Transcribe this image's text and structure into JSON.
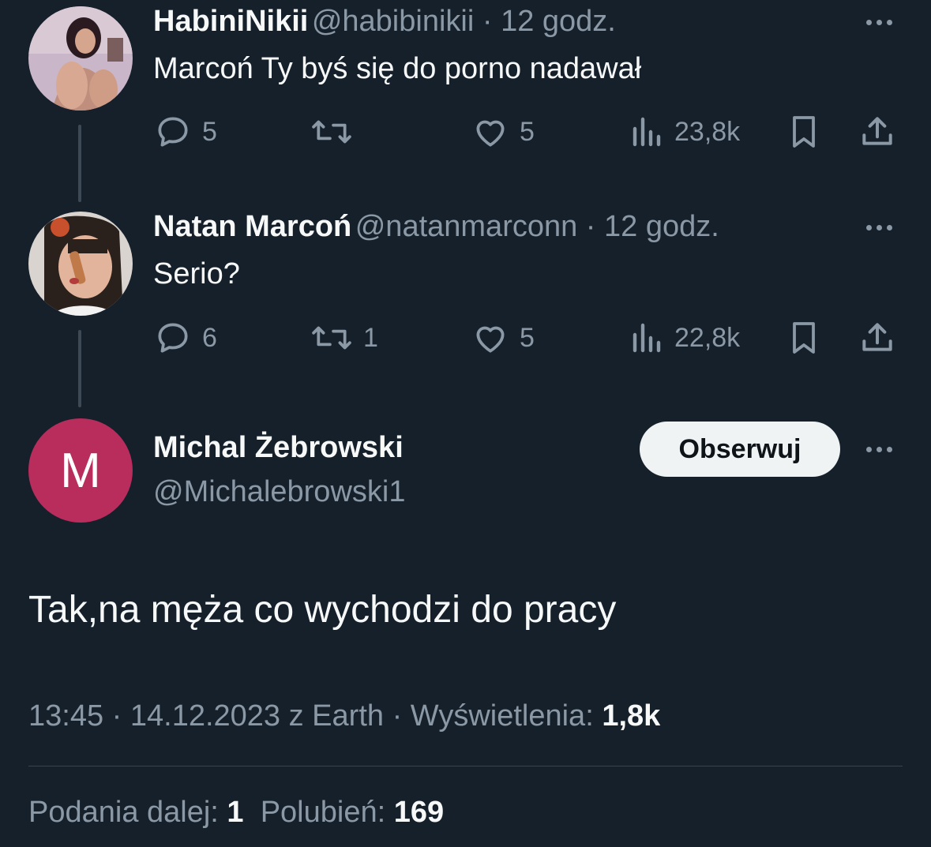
{
  "colors": {
    "background": "#15202b",
    "text_primary": "#f7f9f9",
    "text_secondary": "#8b98a5",
    "avatar_m_bg": "#b92d5d",
    "follow_button_bg": "#eff3f4"
  },
  "tweet1": {
    "name": "HabiniNikii",
    "handle": "@habibinikii",
    "time": "12 godz.",
    "text": "Marcoń Ty byś się do porno nadawał",
    "replies": "5",
    "retweets": "",
    "likes": "5",
    "views": "23,8k",
    "icons": [
      "reply-icon",
      "retweet-icon",
      "like-icon",
      "views-icon",
      "bookmark-icon",
      "share-icon"
    ]
  },
  "tweet2": {
    "name": "Natan Marcoń",
    "handle": "@natanmarconn",
    "time": "12 godz.",
    "text": "Serio?",
    "replies": "6",
    "retweets": "1",
    "likes": "5",
    "views": "22,8k"
  },
  "main": {
    "avatar_letter": "M",
    "name": "Michal Żebrowski",
    "handle": "@Michalebrowski1",
    "follow_label": "Obserwuj",
    "text": "Tak,na męża co wychodzi do pracy",
    "time": "13:45",
    "date": "14.12.2023",
    "source": "z Earth",
    "views_label": "Wyświetlenia:",
    "views_count": "1,8k",
    "retweets_label": "Podania dalej:",
    "retweets_count": "1",
    "likes_label": "Polubień:",
    "likes_count": "169"
  }
}
